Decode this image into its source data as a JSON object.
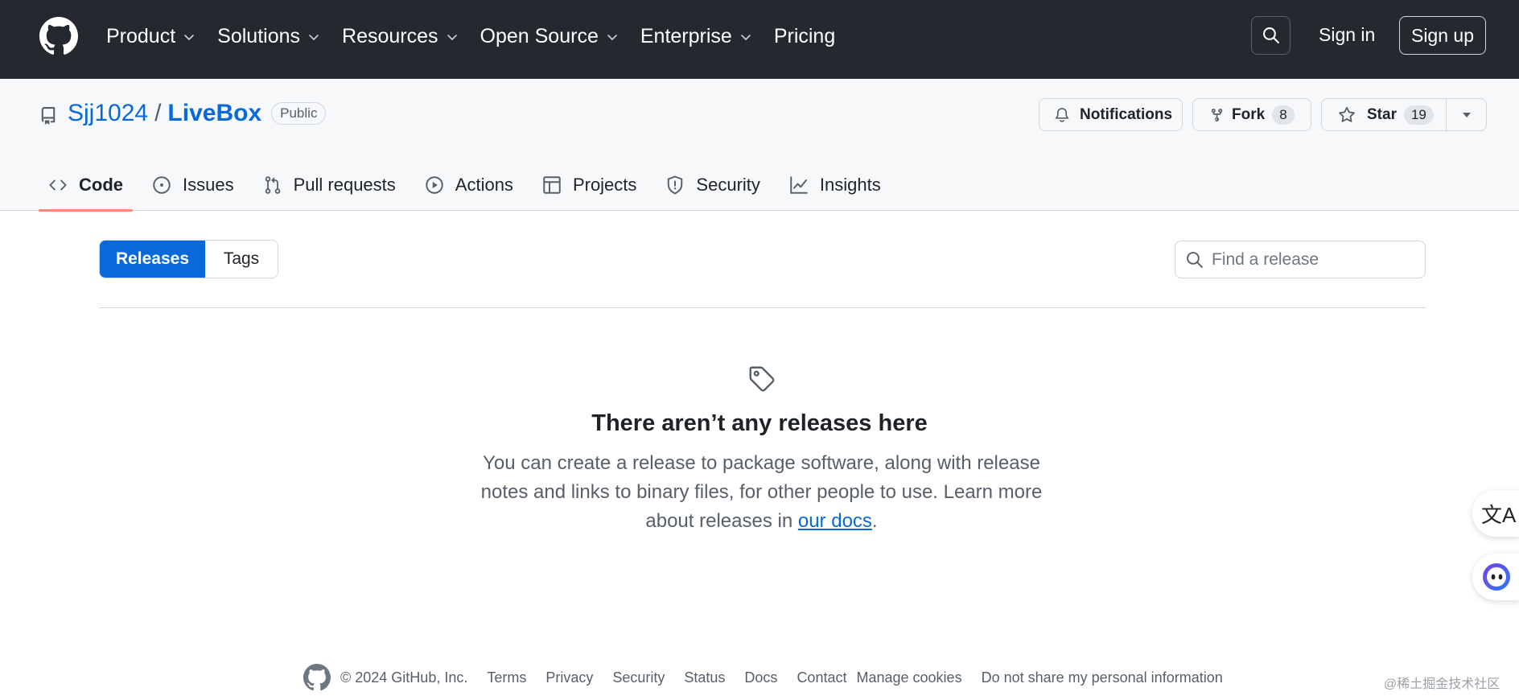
{
  "header": {
    "nav": [
      {
        "label": "Product",
        "has_menu": true
      },
      {
        "label": "Solutions",
        "has_menu": true
      },
      {
        "label": "Resources",
        "has_menu": true
      },
      {
        "label": "Open Source",
        "has_menu": true
      },
      {
        "label": "Enterprise",
        "has_menu": true
      },
      {
        "label": "Pricing",
        "has_menu": false
      }
    ],
    "sign_in": "Sign in",
    "sign_up": "Sign up"
  },
  "repo": {
    "owner": "Sjj1024",
    "separator": "/",
    "name": "LiveBox",
    "visibility": "Public",
    "notifications_label": "Notifications",
    "fork_label": "Fork",
    "fork_count": "8",
    "star_label": "Star",
    "star_count": "19"
  },
  "tabs": [
    {
      "label": "Code",
      "icon": "code-icon",
      "active": true
    },
    {
      "label": "Issues",
      "icon": "issue-icon",
      "active": false
    },
    {
      "label": "Pull requests",
      "icon": "pull-request-icon",
      "active": false
    },
    {
      "label": "Actions",
      "icon": "play-icon",
      "active": false
    },
    {
      "label": "Projects",
      "icon": "table-icon",
      "active": false
    },
    {
      "label": "Security",
      "icon": "shield-icon",
      "active": false
    },
    {
      "label": "Insights",
      "icon": "graph-icon",
      "active": false
    }
  ],
  "releases": {
    "segment": {
      "releases": "Releases",
      "tags": "Tags",
      "selected": "Releases"
    },
    "search_placeholder": "Find a release",
    "empty_title": "There aren’t any releases here",
    "empty_text": "You can create a release to package software, along with release notes and links to binary files, for other people to use. Learn more about releases in ",
    "docs_link": "our docs",
    "empty_text_end": "."
  },
  "footer": {
    "copyright": "© 2024 GitHub, Inc.",
    "links": [
      "Terms",
      "Privacy",
      "Security",
      "Status",
      "Docs",
      "Contact",
      "Manage cookies",
      "Do not share my personal information"
    ]
  },
  "floating": {
    "translate_glyph": "文A"
  },
  "watermark": "@稀土掘金技术社区",
  "colors": {
    "header_bg": "#24292f",
    "accent_blue": "#0969da",
    "tab_underline": "#fd8c73",
    "subtle_bg": "#f6f8fa",
    "border": "#d0d7de"
  }
}
